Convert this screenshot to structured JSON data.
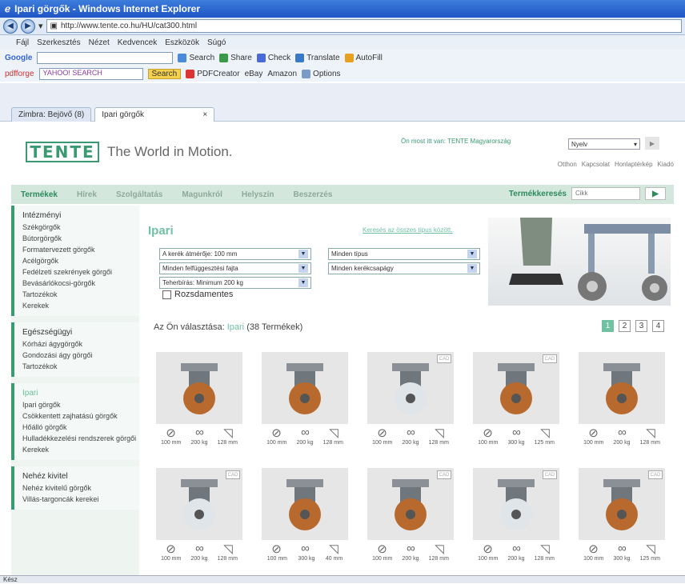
{
  "window": {
    "title": "Ipari görgők - Windows Internet Explorer"
  },
  "address": {
    "url": "http://www.tente.co.hu/HU/cat300.html"
  },
  "menu": [
    "Fájl",
    "Szerkesztés",
    "Nézet",
    "Kedvencek",
    "Eszközök",
    "Súgó"
  ],
  "google_toolbar": {
    "brand": "Google",
    "items": [
      "Search",
      "Share",
      "Check",
      "Translate",
      "AutoFill"
    ]
  },
  "yahoo_toolbar": {
    "brand": "pdfforge",
    "yahoo_label": "YAHOO! SEARCH",
    "search_button": "Search",
    "items": [
      "PDFCreator",
      "eBay",
      "Amazon",
      "Options"
    ]
  },
  "tabs": [
    {
      "label": "Zimbra: Bejövő (8)"
    },
    {
      "label": "Ipari görgők"
    }
  ],
  "header": {
    "logo": "TENTE",
    "slogan": "The World in Motion.",
    "location": "Ön most itt van: TENTE Magyarország",
    "language": "Nyelv",
    "top_links": [
      "Otthon",
      "Kapcsolat",
      "Honlaptérkép",
      "Kiadó"
    ]
  },
  "main_nav": {
    "items": [
      "Termékek",
      "Hírek",
      "Szolgáltatás",
      "Magunkról",
      "Helyszín",
      "Beszerzés"
    ],
    "search_label": "Termékkeresés",
    "search_placeholder": "Cikk"
  },
  "sidebar": [
    {
      "items": [
        "Intézményi",
        "Székgörgők",
        "Bútorgörgők",
        "Formatervezett görgők",
        "Acélgörgők",
        "Fedélzeti szekrények görgői",
        "Bevásárlókocsi-görgők",
        "Tartozékok",
        "Kerekek"
      ]
    },
    {
      "items": [
        "Egészségügyi",
        "Kórházi ágygörgők",
        "Gondozási ágy görgői",
        "Tartozékok"
      ]
    },
    {
      "items": [
        "Ipari",
        "Ipari görgők",
        "Csökkentett zajhatású görgők",
        "Hőálló görgők",
        "Hulladékkezelési rendszerek görgői",
        "Kerekek"
      ]
    },
    {
      "items": [
        "Nehéz kivitel",
        "Nehéz kivitelű görgők",
        "Villás-targoncák kerekei"
      ]
    }
  ],
  "filters": {
    "title": "Ipari",
    "search_all_link": "Keresés az összes típus között.",
    "selects": [
      "A kerék átmérője: 100 mm",
      "Minden felfüggesztési fajta",
      "Teherbírás: Minimum 200 kg",
      "Minden típus",
      "Minden kerékcsapágy"
    ],
    "checkbox_label": "Rozsdamentes"
  },
  "results": {
    "prefix": "Az Ön választása:",
    "category": "Ipari",
    "count": "(38 Termékek)"
  },
  "pagination": [
    "1",
    "2",
    "3",
    "4"
  ],
  "products": [
    {
      "specs": [
        "100 mm",
        "200 kg",
        "128 mm"
      ],
      "cad": false
    },
    {
      "specs": [
        "100 mm",
        "200 kg",
        "128 mm"
      ],
      "cad": false
    },
    {
      "specs": [
        "100 mm",
        "200 kg",
        "128 mm"
      ],
      "cad": true
    },
    {
      "specs": [
        "100 mm",
        "300 kg",
        "125 mm"
      ],
      "cad": true
    },
    {
      "specs": [
        "100 mm",
        "200 kg",
        "128 mm"
      ],
      "cad": false
    },
    {
      "specs": [
        "100 mm",
        "200 kg",
        "128 mm"
      ],
      "cad": true
    },
    {
      "specs": [
        "100 mm",
        "300 kg",
        "40 mm"
      ],
      "cad": false
    },
    {
      "specs": [
        "100 mm",
        "200 kg",
        "128 mm"
      ],
      "cad": true
    },
    {
      "specs": [
        "100 mm",
        "200 kg",
        "128 mm"
      ],
      "cad": true
    },
    {
      "specs": [
        "100 mm",
        "300 kg",
        "125 mm"
      ],
      "cad": true
    }
  ],
  "cad_label": "CAD",
  "status": {
    "text": "Kész"
  }
}
